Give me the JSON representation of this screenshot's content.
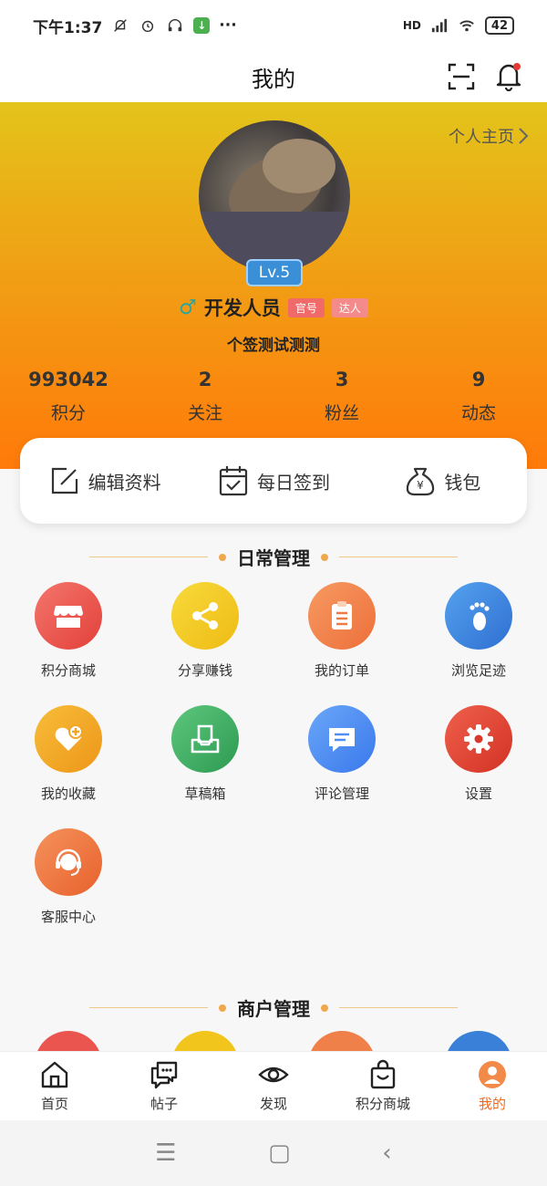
{
  "status_bar": {
    "time": "下午1:37",
    "network": "HD",
    "battery": "42"
  },
  "title_bar": {
    "title": "我的"
  },
  "profile": {
    "home_link": "个人主页",
    "level": "Lv.5",
    "gender_symbol": "♂",
    "username": "开发人员",
    "tags": [
      "官号",
      "达人"
    ],
    "signature": "个签测试测测",
    "stats": [
      {
        "value": "993042",
        "label": "积分"
      },
      {
        "value": "2",
        "label": "关注"
      },
      {
        "value": "3",
        "label": "粉丝"
      },
      {
        "value": "9",
        "label": "动态"
      }
    ]
  },
  "quick_actions": [
    {
      "label": "编辑资料",
      "icon": "edit-icon"
    },
    {
      "label": "每日签到",
      "icon": "calendar-check-icon"
    },
    {
      "label": "钱包",
      "icon": "money-bag-icon"
    }
  ],
  "sections": {
    "daily": {
      "title": "日常管理",
      "items": [
        {
          "label": "积分商城",
          "icon": "store-icon",
          "color": "#ea5550"
        },
        {
          "label": "分享赚钱",
          "icon": "share-icon",
          "color": "#f2c51d"
        },
        {
          "label": "我的订单",
          "icon": "clipboard-icon",
          "color": "#f0804a"
        },
        {
          "label": "浏览足迹",
          "icon": "footprint-icon",
          "color": "#3a7fd8"
        },
        {
          "label": "我的收藏",
          "icon": "heart-plus-icon",
          "color": "#f2a526"
        },
        {
          "label": "草稿箱",
          "icon": "inbox-icon",
          "color": "#3fae62"
        },
        {
          "label": "评论管理",
          "icon": "comment-icon",
          "color": "#4f8ef5"
        },
        {
          "label": "设置",
          "icon": "gear-icon",
          "color": "#e2463a"
        },
        {
          "label": "客服中心",
          "icon": "headset-icon",
          "color": "#f07a40"
        }
      ]
    },
    "merchant": {
      "title": "商户管理"
    }
  },
  "bottom_nav": [
    {
      "label": "首页",
      "icon": "home-icon"
    },
    {
      "label": "帖子",
      "icon": "chat-icon"
    },
    {
      "label": "发现",
      "icon": "eye-icon"
    },
    {
      "label": "积分商城",
      "icon": "shopping-bag-icon"
    },
    {
      "label": "我的",
      "icon": "profile-icon",
      "active": true
    }
  ],
  "system_nav": {
    "menu": "☰",
    "home": "▢",
    "back": "‹"
  }
}
